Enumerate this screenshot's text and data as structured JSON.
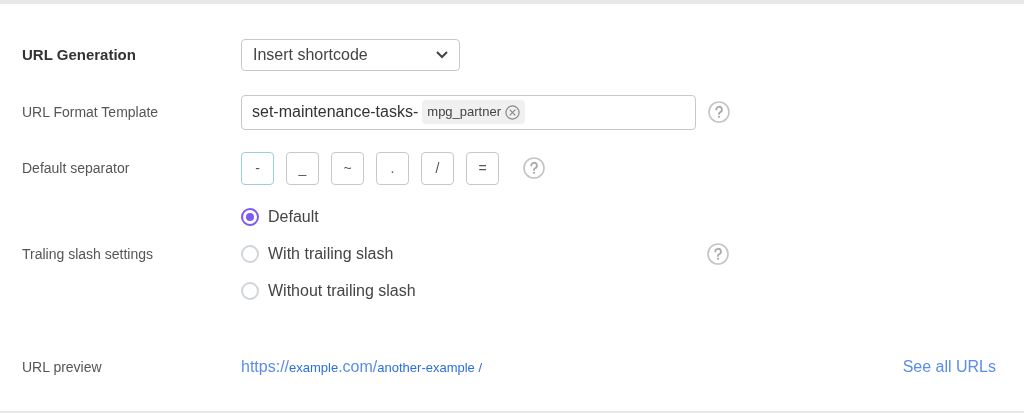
{
  "url_generation": {
    "label": "URL Generation",
    "value": "Insert shortcode"
  },
  "url_format": {
    "label": "URL Format Template",
    "text": "set-maintenance-tasks-",
    "tag": "mpg_partner"
  },
  "separator": {
    "label": "Default separator",
    "options": [
      {
        "label": "-",
        "selected": true
      },
      {
        "label": "_",
        "selected": false
      },
      {
        "label": "~",
        "selected": false
      },
      {
        "label": ".",
        "selected": false
      },
      {
        "label": "/",
        "selected": false
      },
      {
        "label": "=",
        "selected": false
      }
    ]
  },
  "trailing_slash": {
    "label": "Traling slash settings",
    "options": [
      {
        "label": "Default",
        "selected": true
      },
      {
        "label": "With trailing slash",
        "selected": false
      },
      {
        "label": "Without trailing slash",
        "selected": false
      }
    ]
  },
  "url_preview": {
    "label": "URL preview",
    "segments": [
      {
        "text": "https://",
        "kind": "large"
      },
      {
        "text": "example",
        "kind": "small"
      },
      {
        "text": ".com/",
        "kind": "large"
      },
      {
        "text": "another-example /",
        "kind": "small"
      }
    ],
    "link": "See all URLs"
  }
}
